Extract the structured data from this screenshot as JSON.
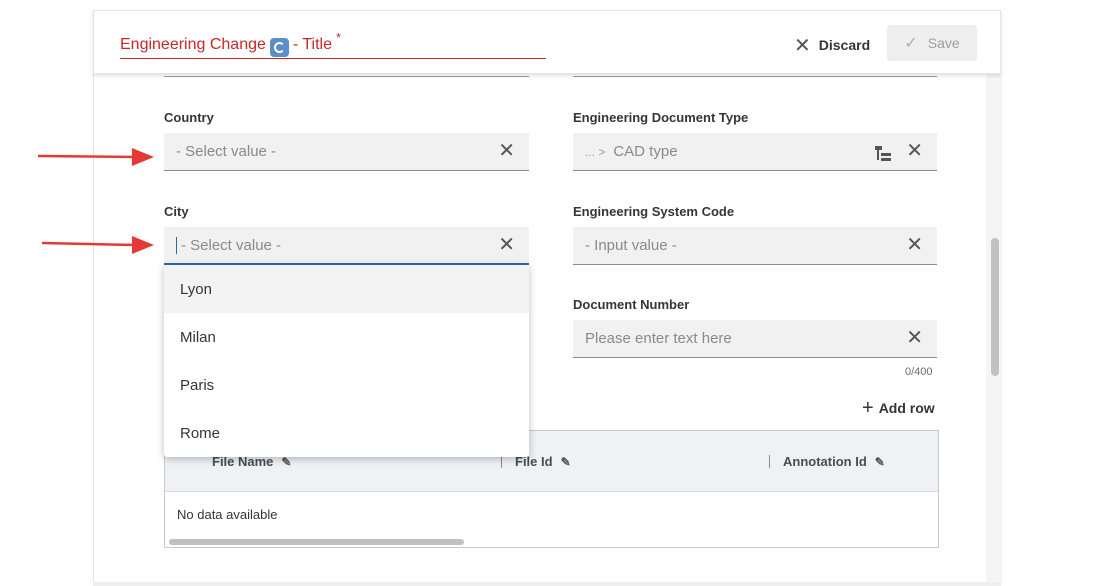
{
  "header": {
    "title_prefix": "Engineering Change",
    "title_icon": "sync-icon",
    "title_suffix": "- Title",
    "required_marker": "*",
    "discard_label": "Discard",
    "save_label": "Save"
  },
  "form": {
    "country": {
      "label": "Country",
      "placeholder": "- Select value -"
    },
    "doc_type": {
      "label": "Engineering Document Type",
      "breadcrumb": "... >",
      "value": "CAD type"
    },
    "city": {
      "label": "City",
      "placeholder": "- Select value -"
    },
    "system_code": {
      "label": "Engineering System Code",
      "placeholder": "- Input value -"
    },
    "doc_number": {
      "label": "Document Number",
      "placeholder": "Please enter text here",
      "counter": "0/400"
    }
  },
  "table": {
    "add_row_label": "Add row",
    "columns": [
      "File Name",
      "File Id",
      "Annotation Id"
    ],
    "empty_text": "No data available"
  },
  "dropdown": {
    "options": [
      "Lyon",
      "Milan",
      "Paris",
      "Rome"
    ],
    "highlighted": "Lyon"
  },
  "colors": {
    "title_red": "#c62828",
    "focus_blue": "#2a6aa8",
    "annotation_arrow": "#e53935"
  }
}
